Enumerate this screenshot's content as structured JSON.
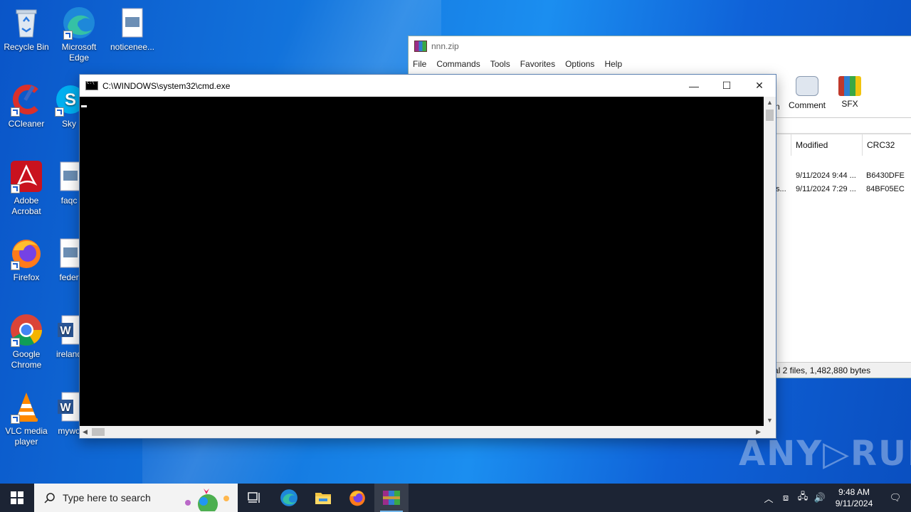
{
  "desktop": {
    "icons": [
      {
        "label": "Recycle Bin"
      },
      {
        "label": "Microsoft Edge"
      },
      {
        "label": "noticenee..."
      },
      {
        "label": "CCleaner"
      },
      {
        "label": "Sky"
      },
      {
        "label": "Adobe Acrobat"
      },
      {
        "label": "faqc"
      },
      {
        "label": "Firefox"
      },
      {
        "label": "feder"
      },
      {
        "label": "Google Chrome"
      },
      {
        "label": "ireland"
      },
      {
        "label": "VLC media player"
      },
      {
        "label": "mywo"
      }
    ]
  },
  "winrar": {
    "title": "nnn.zip",
    "menu": [
      "File",
      "Commands",
      "Tools",
      "Favorites",
      "Options",
      "Help"
    ],
    "toolbar": {
      "partial": "n",
      "comment": "Comment",
      "sfx": "SFX"
    },
    "columns": {
      "modified": "Modified",
      "crc": "CRC32"
    },
    "rows": [
      {
        "name": "",
        "modified": "9/11/2024 9:44 ...",
        "crc": "B6430DFE"
      },
      {
        "name": "s...",
        "modified": "9/11/2024 7:29 ...",
        "crc": "84BF05EC"
      }
    ],
    "status": "al 2 files, 1,482,880 bytes"
  },
  "cmd": {
    "title": "C:\\WINDOWS\\system32\\cmd.exe",
    "minimize": "—",
    "maximize": "☐",
    "close": "✕"
  },
  "watermark": "ANY▷RUN",
  "taskbar": {
    "search_placeholder": "Type here to search",
    "time": "9:48 AM",
    "date": "9/11/2024"
  }
}
